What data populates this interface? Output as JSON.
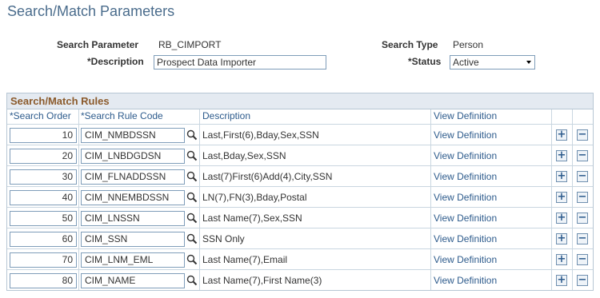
{
  "page": {
    "title": "Search/Match Parameters"
  },
  "form": {
    "search_parameter_label": "Search Parameter",
    "search_parameter_value": "RB_CIMPORT",
    "search_type_label": "Search Type",
    "search_type_value": "Person",
    "description_label": "*Description",
    "description_value": "Prospect Data Importer",
    "status_label": "*Status",
    "status_value": "Active"
  },
  "grid": {
    "title": "Search/Match Rules",
    "headers": {
      "order": "*Search Order",
      "code": "*Search Rule Code",
      "description": "Description",
      "view": "View Definition"
    },
    "rows": [
      {
        "order": "10",
        "code": "CIM_NMBDSSN",
        "description": "Last,First(6),Bday,Sex,SSN",
        "view": "View Definition"
      },
      {
        "order": "20",
        "code": "CIM_LNBDGDSN",
        "description": "Last,Bday,Sex,SSN",
        "view": "View Definition"
      },
      {
        "order": "30",
        "code": "CIM_FLNADDSSN",
        "description": "Last(7)First(6)Add(4),City,SSN",
        "view": "View Definition"
      },
      {
        "order": "40",
        "code": "CIM_NNEMBDSSN",
        "description": "LN(7),FN(3),Bday,Postal",
        "view": "View Definition"
      },
      {
        "order": "50",
        "code": "CIM_LNSSN",
        "description": "Last Name(7),Sex,SSN",
        "view": "View Definition"
      },
      {
        "order": "60",
        "code": "CIM_SSN",
        "description": "SSN Only",
        "view": "View Definition"
      },
      {
        "order": "70",
        "code": "CIM_LNM_EML",
        "description": "Last Name(7),Email",
        "view": "View Definition"
      },
      {
        "order": "80",
        "code": "CIM_NAME",
        "description": "Last Name(7),First Name(3)",
        "view": "View Definition"
      }
    ],
    "add_icon": "+",
    "remove_icon": "−"
  }
}
